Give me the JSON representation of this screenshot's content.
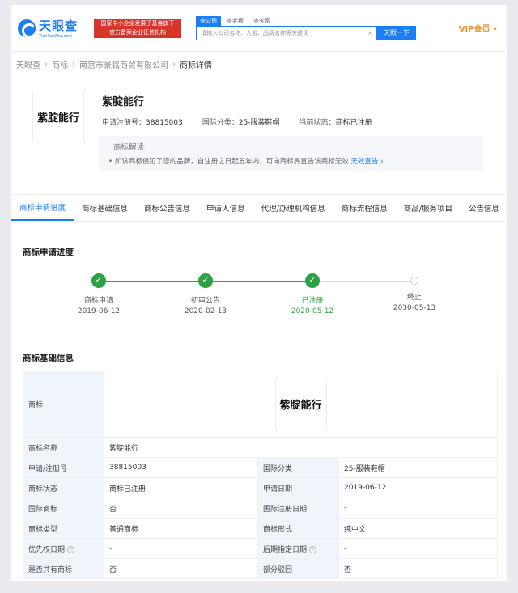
{
  "header": {
    "logo_cn": "天眼查",
    "logo_en": "TianYanCha.com",
    "banner_line1": "国家中小企业发展子基金旗下",
    "banner_line2": "官方备案企业征信机构",
    "search_tabs": [
      "查公司",
      "查老板",
      "查关系"
    ],
    "search_placeholder": "请输入公司名称、人名、品牌名称等关键词",
    "search_clear": "×",
    "search_button": "天眼一下",
    "vip": "VIP会员 ▾"
  },
  "breadcrumb": [
    "天眼查",
    "商标",
    "南宫市景铭商贸有限公司",
    "商标详情"
  ],
  "trademark": {
    "image_text": "紫腚能行",
    "name": "紫腚能行",
    "reg_no_label": "申请注册号：",
    "reg_no": "38815003",
    "class_label": "国际分类：",
    "class": "25-服装鞋帽",
    "status_label": "当前状态：",
    "status": "商标已注册"
  },
  "notice": {
    "title": "商标解读：",
    "text": "• 如该商标侵犯了您的品牌，自注册之日起五年内，可向商标局宣告该商标无效",
    "link": "无效宣告 ›"
  },
  "tabs": [
    "商标申请进度",
    "商标基础信息",
    "商标公告信息",
    "申请人信息",
    "代理/办理机构信息",
    "商标流程信息",
    "商品/服务项目",
    "公告信息"
  ],
  "progress": {
    "title": "商标申请进度",
    "steps": [
      {
        "label": "商标申请",
        "date": "2019-06-12"
      },
      {
        "label": "初审公告",
        "date": "2020-02-13"
      },
      {
        "label": "已注册",
        "date": "2020-05-12"
      },
      {
        "label": "终止",
        "date": "2030-05-13"
      }
    ]
  },
  "basic": {
    "title": "商标基础信息",
    "logo_label": "商标",
    "logo_text": "紫腚能行",
    "name_label": "商标名称",
    "name": "紫腚能行",
    "rows": [
      {
        "k1": "申请/注册号",
        "v1": "38815003",
        "k2": "国际分类",
        "v2": "25-服装鞋帽"
      },
      {
        "k1": "商标状态",
        "v1": "商标已注册",
        "k2": "申请日期",
        "v2": "2019-06-12"
      },
      {
        "k1": "国际商标",
        "v1": "否",
        "k2": "国际注册日期",
        "v2": "-"
      },
      {
        "k1": "商标类型",
        "v1": "普通商标",
        "k2": "商标形式",
        "v2": "纯中文"
      },
      {
        "k1": "优先权日期",
        "v1": "-",
        "k2": "后期指定日期",
        "v2": "-"
      },
      {
        "k1": "是否共有商标",
        "v1": "否",
        "k2": "部分驳回",
        "v2": "否"
      }
    ],
    "help_mark": "?"
  },
  "colors": {
    "accent": "#1d7df2",
    "success": "#2ba244",
    "banner": "#d9342b",
    "vip": "#e8962c"
  }
}
